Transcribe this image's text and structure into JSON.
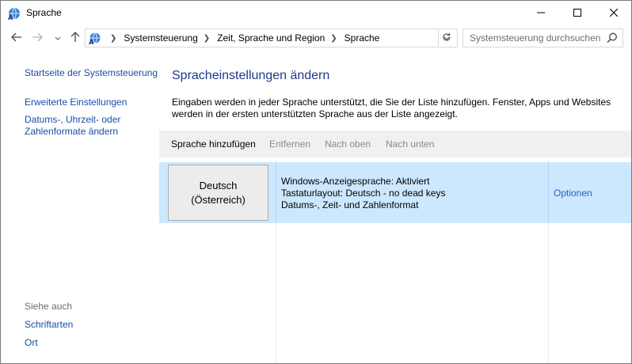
{
  "window": {
    "title": "Sprache",
    "icon": "language-globe-icon"
  },
  "titlebar_buttons": [
    "minimize-icon",
    "maximize-icon",
    "close-icon"
  ],
  "navigation": {
    "back_icon": "arrow-left-icon",
    "forward_icon": "arrow-right-icon",
    "recent_icon": "chevron-down-icon",
    "up_icon": "arrow-up-icon"
  },
  "breadcrumb": {
    "icon": "language-globe-icon",
    "items": [
      "Systemsteuerung",
      "Zeit, Sprache und Region",
      "Sprache"
    ]
  },
  "search": {
    "placeholder": "Systemsteuerung durchsuchen"
  },
  "sidebar": {
    "home": "Startseite der Systemsteuerung",
    "advanced": "Erweiterte Einstellungen",
    "date_formats": "Datums-, Uhrzeit- oder Zahlenformate ändern",
    "see_also": "Siehe auch",
    "fonts": "Schriftarten",
    "location": "Ort"
  },
  "main": {
    "heading": "Spracheinstellungen ändern",
    "description": "Eingaben werden in jeder Sprache unterstützt, die Sie der Liste hinzufügen. Fenster, Apps und Websites werden in der ersten unterstützten Sprache aus der Liste angezeigt."
  },
  "toolbar": {
    "add": "Sprache hinzufügen",
    "remove": "Entfernen",
    "move_up": "Nach oben",
    "move_down": "Nach unten"
  },
  "languages": [
    {
      "name_line1": "Deutsch",
      "name_line2": "(Österreich)",
      "info": [
        "Windows-Anzeigesprache: Aktiviert",
        "Tastaturlayout: Deutsch - no dead keys",
        "Datums-, Zeit- und Zahlenformat"
      ],
      "options": "Optionen",
      "selected": true
    }
  ],
  "colors": {
    "link": "#1a4ea3",
    "heading": "#1e3a8a",
    "selection": "#cce8ff",
    "toolbar_bg": "#f0f0f0",
    "disabled_text": "#8a8a8a"
  }
}
